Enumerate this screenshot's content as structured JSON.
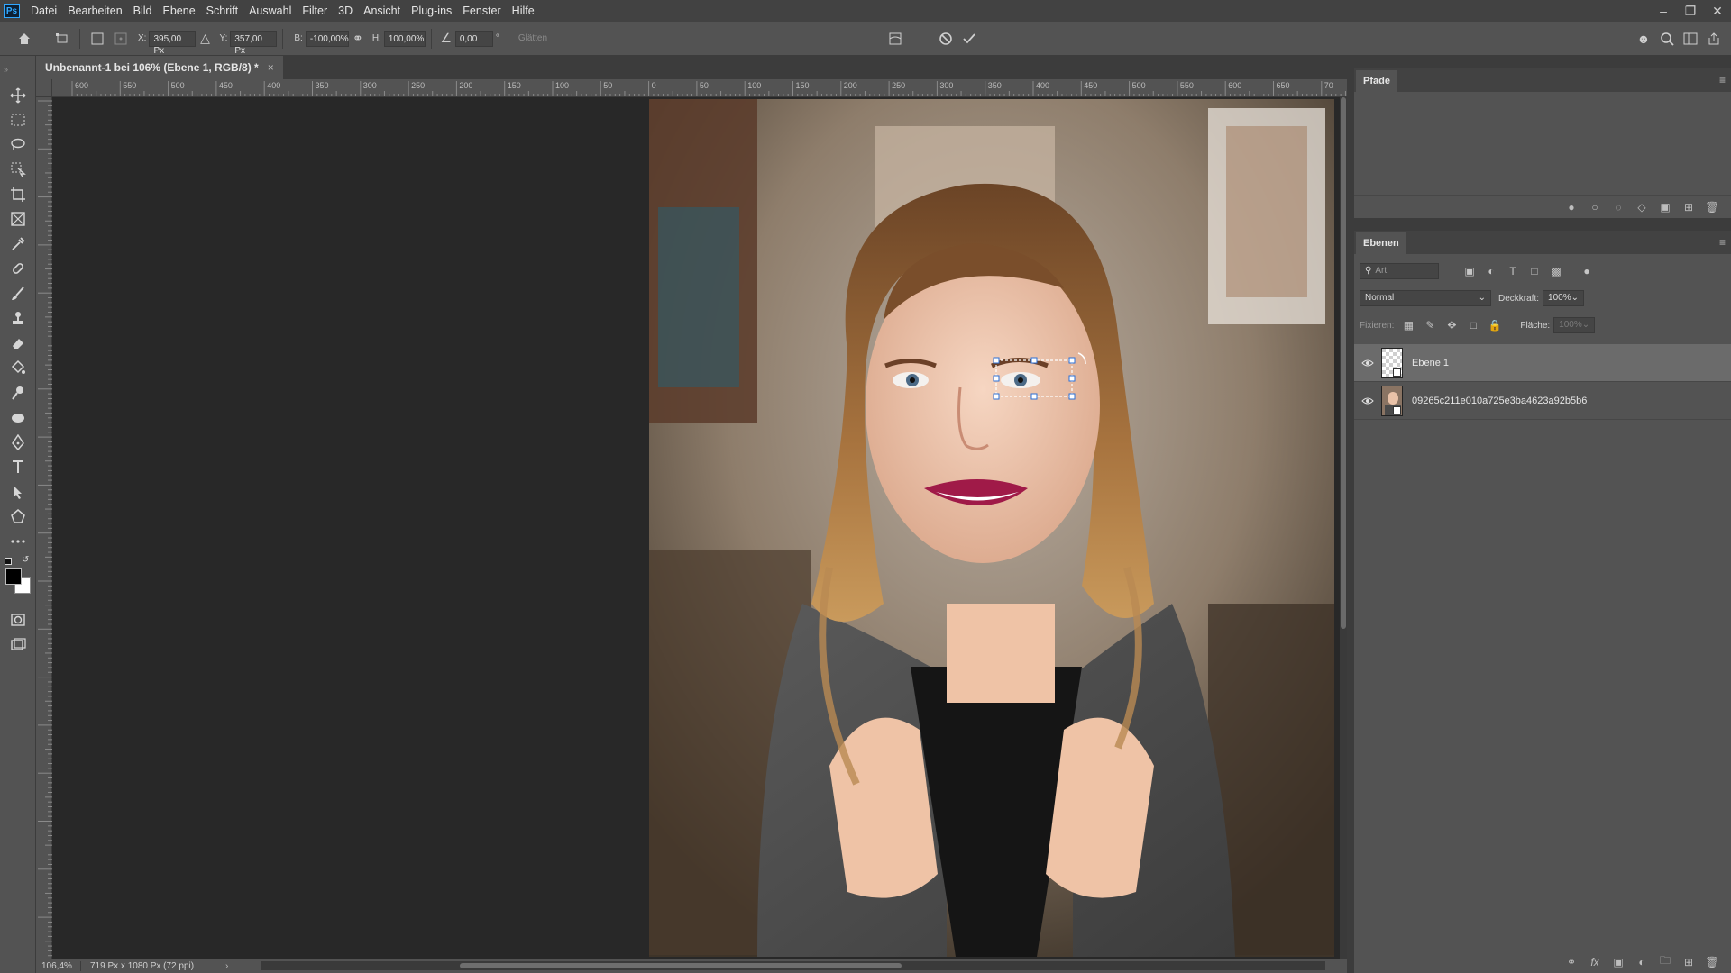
{
  "menubar": {
    "logo": "Ps",
    "items": [
      "Datei",
      "Bearbeiten",
      "Bild",
      "Ebene",
      "Schrift",
      "Auswahl",
      "Filter",
      "3D",
      "Ansicht",
      "Plug-ins",
      "Fenster",
      "Hilfe"
    ]
  },
  "window_controls": [
    "minimize",
    "restore",
    "close"
  ],
  "options": {
    "x_label": "X:",
    "x_value": "395,00 Px",
    "y_label": "Y:",
    "y_value": "357,00 Px",
    "w_label": "B:",
    "w_value": "-100,00%",
    "h_label": "H:",
    "h_value": "100,00%",
    "angle_value": "0,00",
    "angle_unit": "°",
    "smooth_label": "Glätten"
  },
  "document": {
    "tab_title": "Unbenannt-1 bei 106% (Ebene 1, RGB/8) *",
    "close": "×",
    "zoom": "106,4%",
    "info": "719 Px x 1080 Px (72 ppi)"
  },
  "ruler": {
    "labels": [
      "600",
      "550",
      "500",
      "450",
      "400",
      "350",
      "300",
      "250",
      "200",
      "150",
      "100",
      "50",
      "0",
      "50",
      "100",
      "150",
      "200",
      "250",
      "300",
      "350",
      "400",
      "450",
      "500",
      "550",
      "600",
      "650",
      "70"
    ]
  },
  "panels": {
    "paths": {
      "tab": "Pfade"
    },
    "layers": {
      "tab": "Ebenen",
      "search_placeholder": "Art",
      "blend_mode": "Normal",
      "opacity_label": "Deckkraft:",
      "opacity_value": "100%",
      "lock_label": "Fixieren:",
      "fill_label": "Fläche:",
      "fill_value": "100%",
      "items": [
        {
          "name": "Ebene 1",
          "selected": true,
          "visible": true
        },
        {
          "name": "09265c211e010a725e3ba4623a92b5b6",
          "selected": false,
          "visible": true
        }
      ]
    }
  },
  "colors": {
    "accent": "#31a8ff",
    "ui_dark": "#3c3c3c",
    "ui_mid": "#535353",
    "canvas_bg": "#282828"
  }
}
